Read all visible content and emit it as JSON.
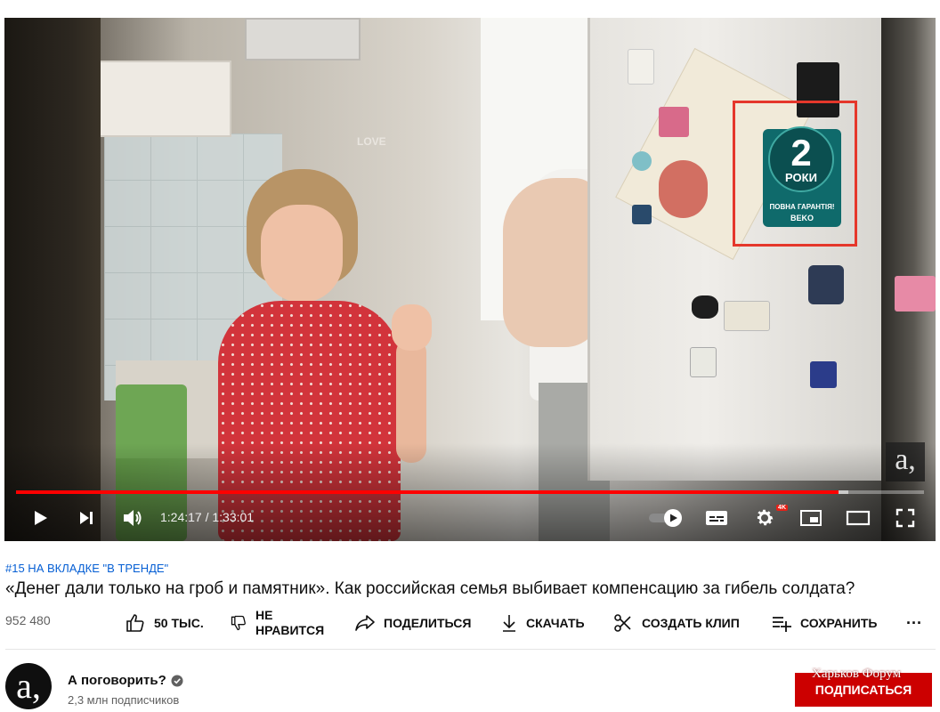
{
  "player": {
    "current_time": "1:24:17",
    "duration": "1:33:01",
    "time_display": "1:24:17 / 1:33:01",
    "progress_fraction": 0.906,
    "buffer_fraction": 0.917,
    "quality_badge": "4K",
    "progress_color": "#ff0000",
    "highlight_color": "#e5372b",
    "scene": {
      "sticker_number": "2",
      "sticker_word": "РОКИ",
      "sticker_guarantee": "ПОВНА ГАРАНТІЯ!",
      "sticker_brand": "BEKO",
      "wall_text": "LOVE",
      "watermark": "а,"
    },
    "icons": [
      "play-icon",
      "next-icon",
      "volume-icon",
      "autoplay-toggle-icon",
      "subtitles-icon",
      "settings-icon",
      "miniplayer-icon",
      "theater-icon",
      "fullscreen-icon"
    ]
  },
  "video": {
    "hashtag": "#15 НА ВКЛАДКЕ \"В ТРЕНДЕ\"",
    "title": "«Денег дали только на гроб и памятник». Как российская семья выбивает компенсацию за гибель солдата?",
    "views": "952 480"
  },
  "actions": {
    "like_count": "50 ТЫС.",
    "dislike_line1": "НЕ",
    "dislike_line2": "НРАВИТСЯ",
    "share": "ПОДЕЛИТЬСЯ",
    "download": "СКАЧАТЬ",
    "clip": "СОЗДАТЬ КЛИП",
    "save": "СОХРАНИТЬ",
    "more": "···"
  },
  "channel": {
    "avatar_glyph": "а,",
    "name": "А поговорить?",
    "verified": true,
    "subscribers": "2,3 млн подписчиков",
    "subscribe_label": "ПОДПИСАТЬСЯ",
    "subscribe_color": "#cc0000"
  },
  "overlay": {
    "watermark_text": "Харьков Форум"
  }
}
